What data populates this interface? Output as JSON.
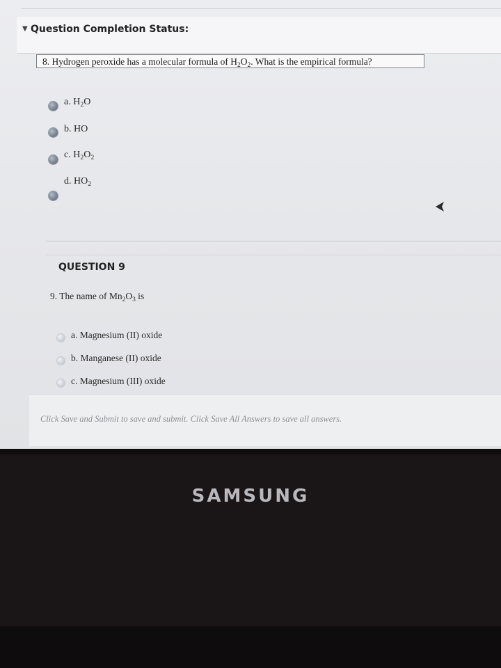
{
  "status": {
    "title": "Question Completion Status:"
  },
  "question8": {
    "text_lead": "8. Hydrogen peroxide has a molecular formula of H",
    "text_sub1": "2",
    "text_mid": "O",
    "text_sub2": "2",
    "text_tail": ". What is the empirical formula?",
    "options": [
      {
        "prefix": "a. H",
        "sub": "2",
        "suffix": "O"
      },
      {
        "prefix": "b. HO",
        "sub": "",
        "suffix": ""
      },
      {
        "prefix": "c. H",
        "sub": "2",
        "suffix": "O",
        "sub2": "2"
      },
      {
        "prefix": "d. HO",
        "sub": "2",
        "suffix": ""
      }
    ]
  },
  "question9": {
    "heading": "QUESTION 9",
    "text_lead": "9. The name of Mn",
    "text_sub1": "2",
    "text_mid": "O",
    "text_sub2": "3",
    "text_tail": " is",
    "options": [
      {
        "label": "a. Magnesium (II) oxide"
      },
      {
        "label": "b. Manganese (II) oxide"
      },
      {
        "label": "c. Magnesium (III) oxide"
      }
    ]
  },
  "footer": {
    "text": "Click Save and Submit to save and submit. Click Save All Answers to save all answers."
  },
  "device": {
    "brand": "SAMSUNG"
  }
}
